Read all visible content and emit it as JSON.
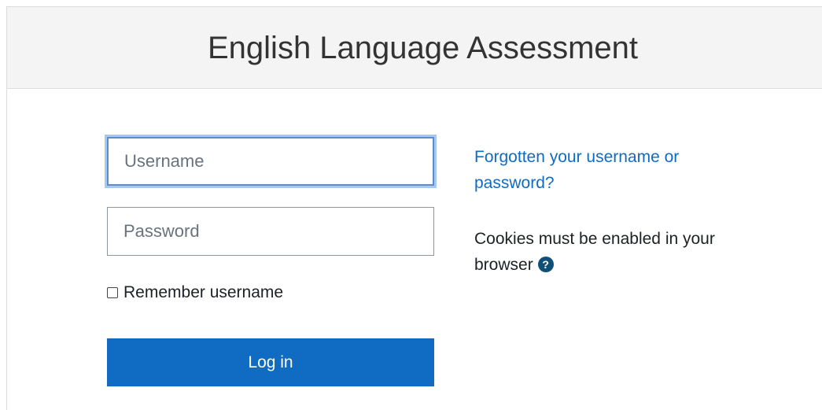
{
  "header": {
    "title": "English Language Assessment"
  },
  "login_form": {
    "username_placeholder": "Username",
    "password_placeholder": "Password",
    "remember_label": "Remember username",
    "remember_checked": false,
    "login_button": "Log in"
  },
  "sidebar": {
    "forgot_link": "Forgotten your username or password?",
    "cookies_text": "Cookies must be enabled in your browser",
    "help_icon": "question-circle-icon"
  },
  "colors": {
    "primary": "#0f6cc2",
    "focus_ring": "#a9c8ef",
    "help_icon": "#0f4f78"
  }
}
